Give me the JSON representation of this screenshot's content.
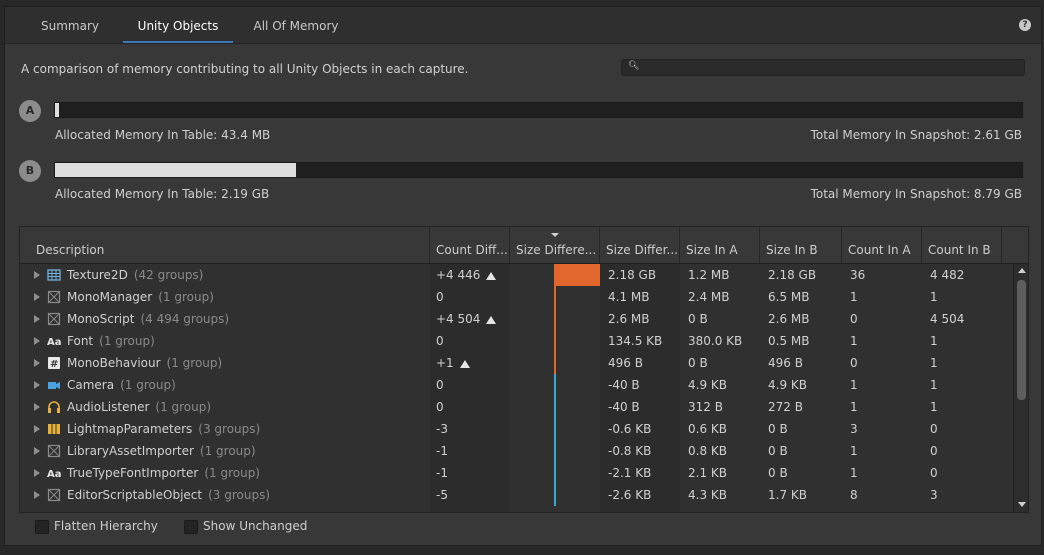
{
  "tabs": [
    {
      "label": "Summary",
      "active": false
    },
    {
      "label": "Unity Objects",
      "active": true
    },
    {
      "label": "All Of Memory",
      "active": false
    }
  ],
  "help_icon": "?",
  "description": "A comparison of memory contributing to all Unity Objects in each capture.",
  "search": {
    "value": "",
    "placeholder": ""
  },
  "snapshot_a": {
    "badge": "A",
    "allocated_label": "Allocated Memory In Table: 43.4 MB",
    "total_label": "Total Memory In Snapshot: 2.61 GB",
    "fill_fraction": 0.004
  },
  "snapshot_b": {
    "badge": "B",
    "allocated_label": "Allocated Memory In Table: 2.19 GB",
    "total_label": "Total Memory In Snapshot: 8.79 GB",
    "fill_fraction": 0.249
  },
  "columns": [
    "Description",
    "Count Diff...",
    "Size Differe...",
    "Size Differ...",
    "Size In A",
    "Size In B",
    "Count In A",
    "Count In B"
  ],
  "rows": [
    {
      "icon": "texture-icon",
      "name": "Texture2D",
      "groups": "(42 groups)",
      "count_diff": "+4 446",
      "count_up": true,
      "size_diff": "2.18 GB",
      "size_a": "1.2 MB",
      "size_b": "2.18 GB",
      "count_a": "36",
      "count_b": "4 482",
      "bar_fraction": 1.0
    },
    {
      "icon": "generic-object-icon",
      "name": "MonoManager",
      "groups": "(1 group)",
      "count_diff": "0",
      "count_up": false,
      "size_diff": "4.1 MB",
      "size_a": "2.4 MB",
      "size_b": "6.5 MB",
      "count_a": "1",
      "count_b": "1",
      "bar_fraction": 0.002
    },
    {
      "icon": "generic-object-icon",
      "name": "MonoScript",
      "groups": "(4 494 groups)",
      "count_diff": "+4 504",
      "count_up": true,
      "size_diff": "2.6 MB",
      "size_a": "0 B",
      "size_b": "2.6 MB",
      "count_a": "0",
      "count_b": "4 504",
      "bar_fraction": 0.001
    },
    {
      "icon": "font-icon",
      "name": "Font",
      "groups": "(1 group)",
      "count_diff": "0",
      "count_up": false,
      "size_diff": "134.5 KB",
      "size_a": "380.0 KB",
      "size_b": "0.5 MB",
      "count_a": "1",
      "count_b": "1",
      "bar_fraction": 0.0
    },
    {
      "icon": "script-hash-icon",
      "name": "MonoBehaviour",
      "groups": "(1 group)",
      "count_diff": "+1",
      "count_up": true,
      "size_diff": "496 B",
      "size_a": "0 B",
      "size_b": "496 B",
      "count_a": "0",
      "count_b": "1",
      "bar_fraction": 0.0
    },
    {
      "icon": "camera-icon",
      "name": "Camera",
      "groups": "(1 group)",
      "count_diff": "0",
      "count_up": false,
      "size_diff": "-40 B",
      "size_a": "4.9 KB",
      "size_b": "4.9 KB",
      "count_a": "1",
      "count_b": "1",
      "bar_fraction": 0.0
    },
    {
      "icon": "headphones-icon",
      "name": "AudioListener",
      "groups": "(1 group)",
      "count_diff": "0",
      "count_up": false,
      "size_diff": "-40 B",
      "size_a": "312 B",
      "size_b": "272 B",
      "count_a": "1",
      "count_b": "1",
      "bar_fraction": 0.0
    },
    {
      "icon": "lightmap-icon",
      "name": "LightmapParameters",
      "groups": "(3 groups)",
      "count_diff": "-3",
      "count_up": false,
      "size_diff": "-0.6 KB",
      "size_a": "0.6 KB",
      "size_b": "0 B",
      "count_a": "3",
      "count_b": "0",
      "bar_fraction": 0.0
    },
    {
      "icon": "generic-object-icon",
      "name": "LibraryAssetImporter",
      "groups": "(1 group)",
      "count_diff": "-1",
      "count_up": false,
      "size_diff": "-0.8 KB",
      "size_a": "0.8 KB",
      "size_b": "0 B",
      "count_a": "1",
      "count_b": "0",
      "bar_fraction": 0.0
    },
    {
      "icon": "font-icon",
      "name": "TrueTypeFontImporter",
      "groups": "(1 group)",
      "count_diff": "-1",
      "count_up": false,
      "size_diff": "-2.1 KB",
      "size_a": "2.1 KB",
      "size_b": "0 B",
      "count_a": "1",
      "count_b": "0",
      "bar_fraction": 0.0
    },
    {
      "icon": "generic-object-icon",
      "name": "EditorScriptableObject",
      "groups": "(3 groups)",
      "count_diff": "-5",
      "count_up": false,
      "size_diff": "-2.6 KB",
      "size_a": "4.3 KB",
      "size_b": "1.7 KB",
      "count_a": "8",
      "count_b": "3",
      "bar_fraction": 0.0
    }
  ],
  "footer": {
    "flatten_label": "Flatten Hierarchy",
    "flatten_checked": false,
    "unchanged_label": "Show Unchanged",
    "unchanged_checked": false
  },
  "colors": {
    "increase_bar": "#e2672c",
    "decrease_line": "#3aa6d8",
    "tab_underline": "#3a79bb"
  }
}
